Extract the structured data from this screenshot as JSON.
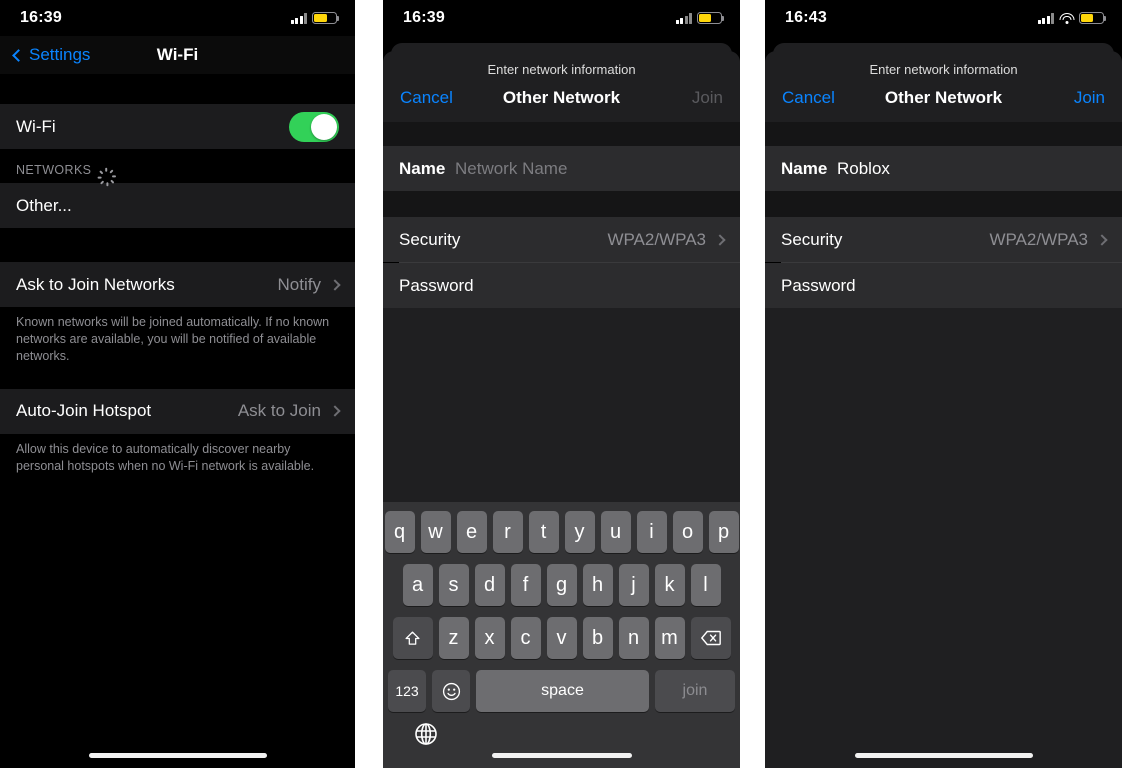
{
  "colors": {
    "accent_blue": "#0a84ff",
    "toggle_green": "#32d158",
    "battery_yellow": "#ffd60a",
    "cell_bg": "#1c1c1e",
    "sheet_bg": "#1f1f21",
    "secondary_text": "#8e8e93"
  },
  "panel1": {
    "status": {
      "time": "16:39",
      "battery_icon": "battery-low-power-icon",
      "signal_icon": "cellular-signal-icon"
    },
    "nav": {
      "back_label": "Settings",
      "back_icon": "chevron-left-icon",
      "title": "Wi-Fi"
    },
    "wifi_row": {
      "label": "Wi-Fi",
      "toggle_state": "on"
    },
    "networks_header": {
      "label": "NETWORKS",
      "spinner": "activity-spinner-icon"
    },
    "other_row": {
      "label": "Other..."
    },
    "ask_to_join": {
      "label": "Ask to Join Networks",
      "value": "Notify",
      "chevron": "chevron-right-icon"
    },
    "ask_to_join_footnote": "Known networks will be joined automatically. If no known networks are available, you will be notified of available networks.",
    "auto_join_hotspot": {
      "label": "Auto-Join Hotspot",
      "value": "Ask to Join",
      "chevron": "chevron-right-icon"
    },
    "auto_join_footnote": "Allow this device to automatically discover nearby personal hotspots when no Wi-Fi network is available."
  },
  "panel2": {
    "status": {
      "time": "16:39",
      "battery_icon": "battery-low-power-icon",
      "signal_icon": "cellular-signal-icon"
    },
    "sheet": {
      "subtitle": "Enter network information",
      "cancel_label": "Cancel",
      "title": "Other Network",
      "join_label": "Join",
      "join_enabled": false
    },
    "form": {
      "name_label": "Name",
      "name_value": "",
      "name_placeholder": "Network Name",
      "security_label": "Security",
      "security_value": "WPA2/WPA3",
      "security_chevron": "chevron-right-icon",
      "password_label": "Password",
      "password_value": "",
      "password_placeholder": ""
    },
    "keyboard": {
      "row1": [
        "q",
        "w",
        "e",
        "r",
        "t",
        "y",
        "u",
        "i",
        "o",
        "p"
      ],
      "row2": [
        "a",
        "s",
        "d",
        "f",
        "g",
        "h",
        "j",
        "k",
        "l"
      ],
      "row3": [
        "z",
        "x",
        "c",
        "v",
        "b",
        "n",
        "m"
      ],
      "shift_icon": "shift-up-arrow-icon",
      "backspace_icon": "backspace-delete-icon",
      "numbers_label": "123",
      "emoji_icon": "emoji-smiley-icon",
      "space_label": "space",
      "return_label": "join",
      "globe_icon": "globe-language-icon"
    }
  },
  "panel3": {
    "status": {
      "time": "16:43",
      "battery_icon": "battery-low-power-icon",
      "signal_icon": "cellular-signal-icon",
      "wifi_icon": "wifi-icon"
    },
    "sheet": {
      "subtitle": "Enter network information",
      "cancel_label": "Cancel",
      "title": "Other Network",
      "join_label": "Join",
      "join_enabled": true
    },
    "form": {
      "name_label": "Name",
      "name_value": "Roblox",
      "name_placeholder": "Network Name",
      "security_label": "Security",
      "security_value": "WPA2/WPA3",
      "security_chevron": "chevron-right-icon",
      "password_label": "Password",
      "password_value": ""
    }
  }
}
